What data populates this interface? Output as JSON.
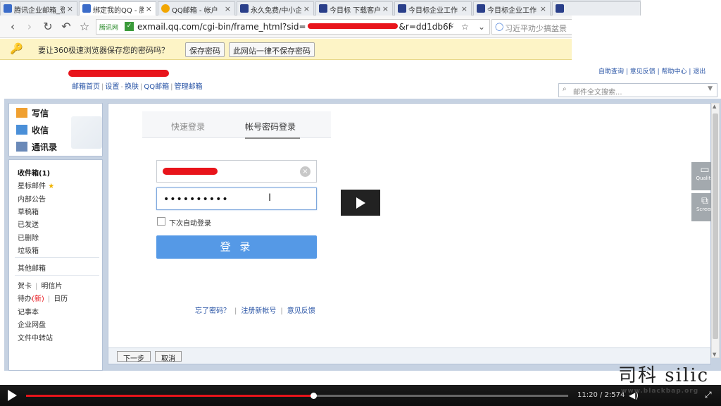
{
  "browser": {
    "tabs": [
      {
        "label": "腾讯企业邮箱_登",
        "icon_color": "#3b6cc9",
        "active": false
      },
      {
        "label": "绑定我的QQ - 腾",
        "icon_color": "#3b6cc9",
        "active": true
      },
      {
        "label": "QQ邮箱 - 帐户",
        "icon_color": "#f2a600",
        "active": false
      },
      {
        "label": "永久免费/中小企",
        "icon_color": "#2a3f8a",
        "active": false
      },
      {
        "label": "今目标 下载客户",
        "icon_color": "#2a3f8a",
        "active": false
      },
      {
        "label": "今目标企业工作",
        "icon_color": "#2a3f8a",
        "active": false
      },
      {
        "label": "今目标企业工作",
        "icon_color": "#2a3f8a",
        "active": false
      },
      {
        "label": "",
        "icon_color": "#2a3f8a",
        "active": false
      }
    ],
    "tab_close": "×",
    "nav": {
      "back": "‹",
      "forward": "›",
      "reload": "↻",
      "undo": "↶",
      "bookmark": "☆"
    },
    "address": {
      "site_label": "腾讯网",
      "secure_icon": "✓",
      "url_prefix": "exmail.qq.com/cgi-bin/frame_html?sid=",
      "url_suffix": "&r=dd1db6f"
    },
    "address_icons": {
      "lightning": "⚡",
      "star": "☆",
      "dropdown": "⌄"
    },
    "search_placeholder": "习近平劝少搞盆景"
  },
  "password_bar": {
    "message": "要让360极速浏览器保存您的密码吗？",
    "save_label": "保存密码",
    "never_label": "此网站一律不保存密码"
  },
  "mail_header": {
    "links": [
      "邮箱首页",
      "设置",
      "换肤",
      "QQ邮箱",
      "管理邮箱"
    ],
    "top_right": "自助查询 | 意见反馈 | 帮助中心 | 退出",
    "search_placeholder": "邮件全文搜索..."
  },
  "sidebar": {
    "compose": "写信",
    "inbox_action": "收信",
    "contacts": "通讯录",
    "folders": {
      "inbox": "收件箱(1)",
      "starred": "星标邮件",
      "notice": "内部公告",
      "drafts": "草稿箱",
      "sent": "已发送",
      "deleted": "已删除",
      "spam": "垃圾箱",
      "other": "其他邮箱",
      "card": "贺卡",
      "postcard": "明信片",
      "todo": "待办",
      "todo_badge": "(新)",
      "calendar": "日历",
      "notes": "记事本",
      "disk": "企业网盘",
      "transfer": "文件中转站"
    }
  },
  "login": {
    "tab_quick": "快速登录",
    "tab_password": "帐号密码登录",
    "password_value": "••••••••••",
    "auto_login": "下次自动登录",
    "login_button": "登 录",
    "forgot": "忘了密码？",
    "register": "注册新帐号",
    "feedback": "意见反馈"
  },
  "footer_buttons": {
    "next": "下一步",
    "cancel": "取消"
  },
  "side_widgets": {
    "quality": "Quality",
    "screen": "Screen"
  },
  "player": {
    "time": "11:20 / 2:574",
    "progress": 0.53
  },
  "watermark": {
    "text": "司科 silic",
    "subtext": "www.blackbap.org"
  }
}
